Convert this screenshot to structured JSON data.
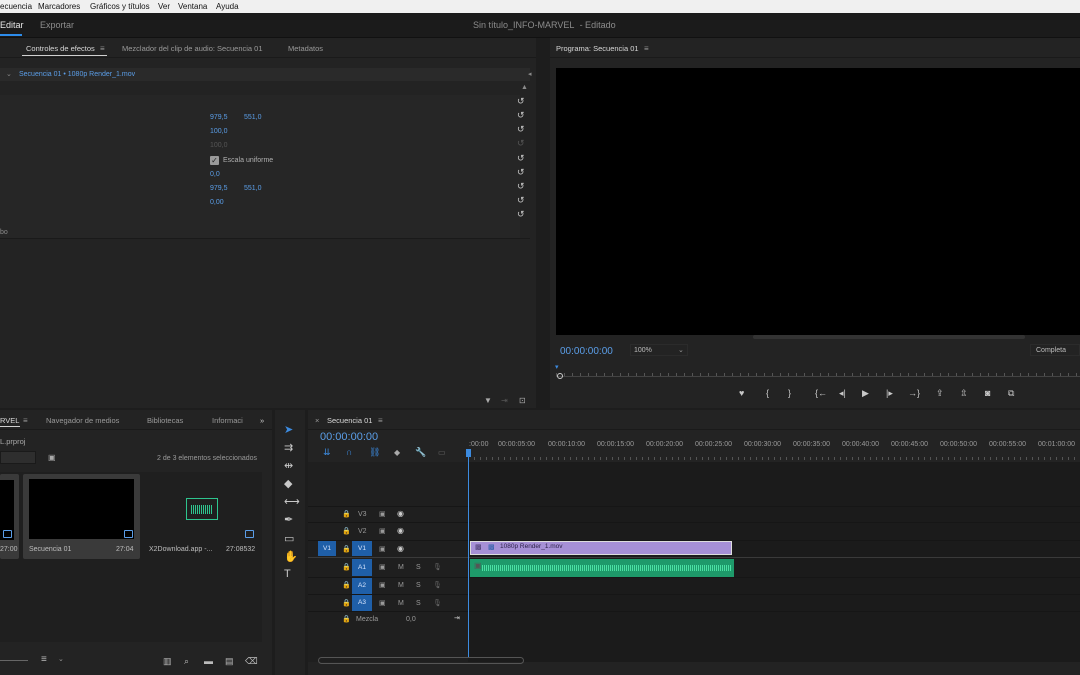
{
  "menu": [
    "ecuencia",
    "Marcadores",
    "Gráficos y títulos",
    "Ver",
    "Ventana",
    "Ayuda"
  ],
  "workspace": {
    "edit": "Editar",
    "export": "Exportar",
    "title": "Sin título_INFO-MARVEL",
    "title_suffix": "- Editado"
  },
  "effect_controls": {
    "tabs": [
      "Controles de efectos",
      "Mezclador del clip de audio: Secuencia 01",
      "Metadatos"
    ],
    "menu_icon": "≡",
    "clip_path": "Secuencia 01 • 1080p Render_1.mov",
    "position_x": "979,5",
    "position_y": "551,0",
    "scale": "100,0",
    "scale_width": "100,0",
    "uniform_scale": "Escala uniforme",
    "rotation": "0,0",
    "anchor_x": "979,5",
    "anchor_y": "551,0",
    "flicker": "0,00",
    "partial_label": "bo"
  },
  "program": {
    "title": "Programa: Secuencia 01",
    "timecode": "00:00:00:00",
    "zoom": "100%",
    "resolution": "Completa"
  },
  "project": {
    "tabs": [
      "RVEL",
      "Navegador de medios",
      "Bibliotecas",
      "Informaci"
    ],
    "overflow": "»",
    "file": "L.prproj",
    "selection": "2 de 3 elementos seleccionados",
    "items": [
      {
        "name": "",
        "duration": "27:00"
      },
      {
        "name": "Secuencia 01",
        "duration": "27:04"
      },
      {
        "name": "X2Download.app -...",
        "duration": "27:08532"
      }
    ]
  },
  "timeline": {
    "tab": "Secuencia 01",
    "close": "×",
    "timecode": "00:00:00:00",
    "ruler": [
      ":00:00",
      "00:00:05:00",
      "00:00:10:00",
      "00:00:15:00",
      "00:00:20:00",
      "00:00:25:00",
      "00:00:30:00",
      "00:00:35:00",
      "00:00:40:00",
      "00:00:45:00",
      "00:00:50:00",
      "00:00:55:00",
      "00:01:00:00"
    ],
    "video_tracks": [
      "V3",
      "V2",
      "V1"
    ],
    "source_v": "V1",
    "audio_tracks": [
      "A1",
      "A2",
      "A3"
    ],
    "mute": "M",
    "solo": "S",
    "mix_label": "Mezcla",
    "mix_value": "0,0",
    "clip_name": "1080p Render_1.mov"
  }
}
